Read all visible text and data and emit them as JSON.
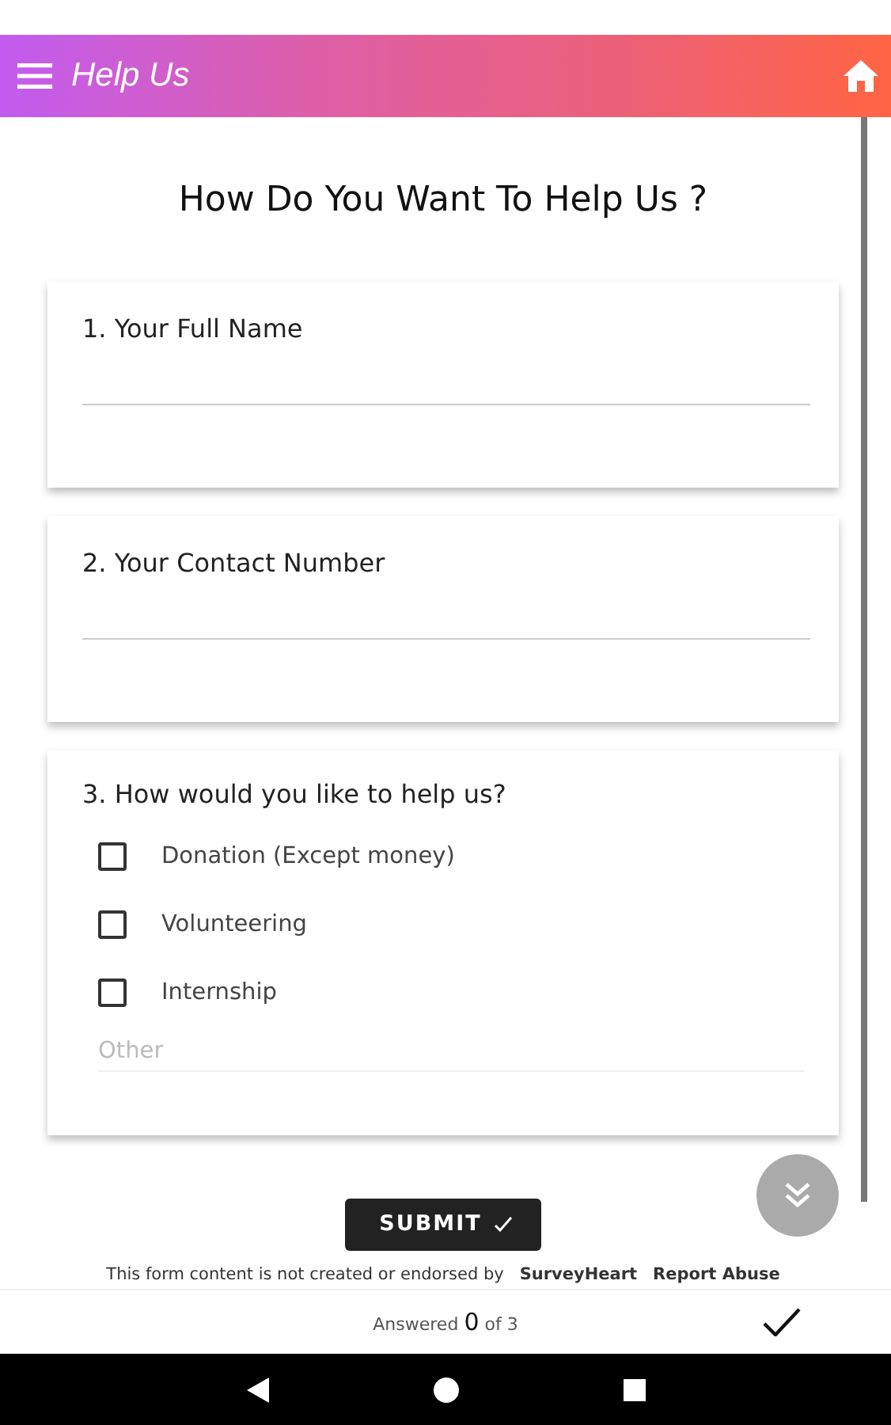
{
  "app_bar": {
    "title": "Help Us"
  },
  "form": {
    "title": "How Do You Want To Help Us ?",
    "questions": [
      {
        "kind": "text",
        "label": "1. Your Full Name"
      },
      {
        "kind": "text",
        "label": "2. Your Contact Number"
      },
      {
        "kind": "checkboxes",
        "label": "3. How would you like to help us?",
        "options": [
          {
            "label": "Donation (Except money)",
            "checked": false
          },
          {
            "label": "Volunteering",
            "checked": false
          },
          {
            "label": "Internship",
            "checked": false
          }
        ],
        "other_placeholder": "Other"
      }
    ],
    "submit": "SUBMIT",
    "disclaimer": "This form content is not created or endorsed by",
    "brand": "SurveyHeart",
    "report": "Report Abuse"
  },
  "footer": {
    "prefix": "Answered",
    "count": "0",
    "suffix": "of 3"
  }
}
